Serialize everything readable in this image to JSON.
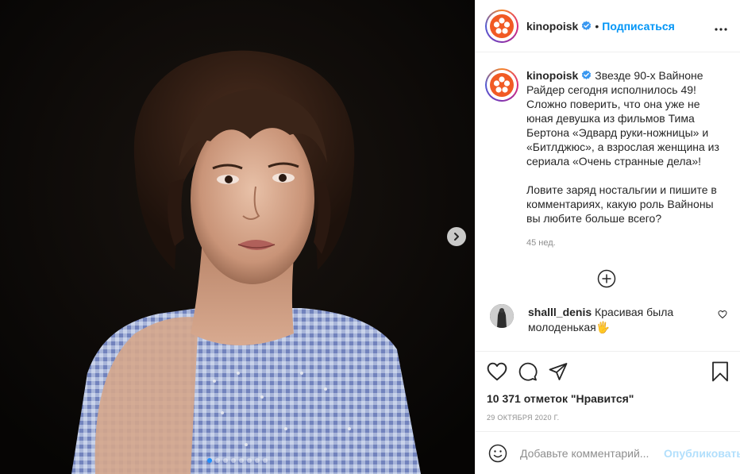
{
  "post": {
    "media_alt": "Winona Ryder portrait",
    "carousel": {
      "count": 8,
      "active_index": 0
    }
  },
  "header": {
    "username": "kinopoisk",
    "separator": "•",
    "follow_label": "Подписаться",
    "more_icon": "more-horizontal-icon"
  },
  "caption": {
    "username": "kinopoisk",
    "text": "Звезде 90-х Вайноне Райдер сегодня исполнилось 49! Сложно поверить, что она уже не юная девушка из фильмов Тима Бертона «Эдвард руки-ножницы» и «Битлджюс», а взрослая женщина из сериала «Очень странные дела»!\n\nЛовите заряд ностальгии и пишите в комментариях, какую роль Вайноны вы любите больше всего?",
    "time": "45 нед."
  },
  "comments": [
    {
      "username": "shalll_denis",
      "text": "Красивая была молоденькая🖐"
    }
  ],
  "actions": {
    "likes_text": "10 371 отметок \"Нравится\"",
    "date": "29 октября 2020 г."
  },
  "add_comment": {
    "placeholder": "Добавьте комментарий...",
    "publish_label": "Опубликовать"
  },
  "colors": {
    "accent": "#0095f6",
    "publish_disabled": "#b2dffc",
    "muted": "#8e8e8e",
    "logo_orange": "#f15a24",
    "carousel_active_dot": "#1e90ff"
  }
}
